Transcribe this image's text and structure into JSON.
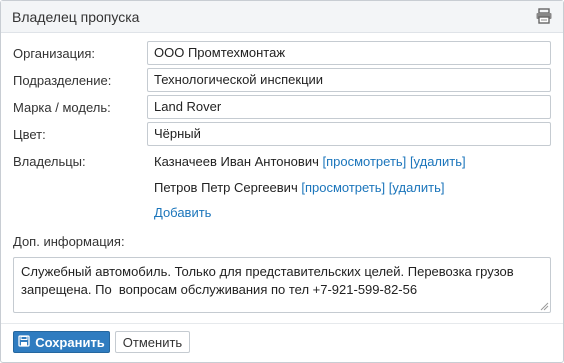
{
  "header": {
    "title": "Владелец пропуска"
  },
  "fields": [
    {
      "label": "Организация:",
      "value": "ООО Промтехмонтаж"
    },
    {
      "label": "Подразделение:",
      "value": "Технологической инспекции"
    },
    {
      "label": "Марка / модель:",
      "value": "Land Rover"
    },
    {
      "label": "Цвет:",
      "value": "Чёрный"
    }
  ],
  "owners": {
    "label": "Владельцы:",
    "items": [
      {
        "name": "Казначеев Иван Антонович",
        "view_link": "[просмотреть]",
        "delete_link": "[удалить]"
      },
      {
        "name": "Петров Петр Сергеевич",
        "view_link": "[просмотреть]",
        "delete_link": "[удалить]"
      }
    ],
    "add_link": "Добавить"
  },
  "extra_info": {
    "label": "Доп. информация:",
    "value": "Служебный автомобиль. Только для представительских целей. Перевозка грузов запрещена. По  вопросам обслуживания по тел +7-921-599-82-56"
  },
  "buttons": {
    "save": "Сохранить",
    "cancel": "Отменить"
  },
  "icons": {
    "print": "printer-icon",
    "save": "save-icon"
  },
  "colors": {
    "accent": "#2f7cc0",
    "link": "#1b75bb"
  }
}
